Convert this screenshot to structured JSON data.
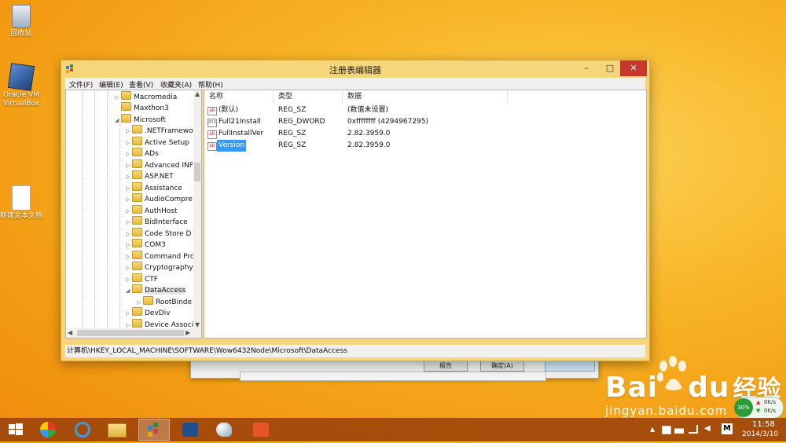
{
  "desktop": {
    "icons": [
      {
        "label": "回收站"
      },
      {
        "label": "Oracle VM VirtualBox"
      },
      {
        "label": "新建文本文档"
      }
    ]
  },
  "window": {
    "title": "注册表编辑器",
    "controls": {
      "minimize": "–",
      "maximize": "□",
      "close": "✕"
    },
    "menu": [
      "文件(F)",
      "编辑(E)",
      "查看(V)",
      "收藏夹(A)",
      "帮助(H)"
    ],
    "tree": [
      {
        "label": "Macromedia",
        "expander": "▷"
      },
      {
        "label": "Maxthon3",
        "expander": ""
      },
      {
        "label": "Microsoft",
        "expander": "◢"
      },
      {
        "label": ".NETFramewo",
        "expander": "▷"
      },
      {
        "label": "Active Setup",
        "expander": "▷"
      },
      {
        "label": "ADs",
        "expander": "▷"
      },
      {
        "label": "Advanced INF",
        "expander": "▷"
      },
      {
        "label": "ASP.NET",
        "expander": "▷"
      },
      {
        "label": "Assistance",
        "expander": "▷"
      },
      {
        "label": "AudioCompre",
        "expander": "▷"
      },
      {
        "label": "AuthHost",
        "expander": "▷"
      },
      {
        "label": "BidInterface",
        "expander": "▷"
      },
      {
        "label": "Code Store D",
        "expander": "▷"
      },
      {
        "label": "COM3",
        "expander": "▷"
      },
      {
        "label": "Command Pro",
        "expander": "▷"
      },
      {
        "label": "Cryptography",
        "expander": "▷"
      },
      {
        "label": "CTF",
        "expander": "▷"
      },
      {
        "label": "DataAccess",
        "expander": "◢"
      },
      {
        "label": "RootBinde",
        "expander": "▷"
      },
      {
        "label": "DevDiv",
        "expander": "▷"
      },
      {
        "label": "Device Associ",
        "expander": "▷"
      }
    ],
    "columns": [
      "名称",
      "类型",
      "数据"
    ],
    "values": [
      {
        "icon": "ab",
        "name": "(默认)",
        "type": "REG_SZ",
        "data": "(数值未设置)"
      },
      {
        "icon": "011",
        "name": "Full21Install",
        "type": "REG_DWORD",
        "data": "0xffffffff (4294967295)"
      },
      {
        "icon": "ab",
        "name": "FullInstallVer",
        "type": "REG_SZ",
        "data": "2.82.3959.0"
      },
      {
        "icon": "ab",
        "name": "Version",
        "type": "REG_SZ",
        "data": "2.82.3959.0"
      }
    ],
    "status_path": "计算机\\HKEY_LOCAL_MACHINE\\SOFTWARE\\Wow6432Node\\Microsoft\\DataAccess"
  },
  "background_dialog": {
    "btn1": "报告",
    "btn2": "确定(A)"
  },
  "taskbar": {
    "time": "11:58",
    "date": "2014/3/10",
    "ime": "M",
    "net_percent": "30%",
    "net_up": "0K/s",
    "net_down": "0K/s"
  },
  "watermark": {
    "brand": "Bai",
    "brand_mid": "du",
    "cn": "经验",
    "url": "jingyan.baidu.com"
  }
}
